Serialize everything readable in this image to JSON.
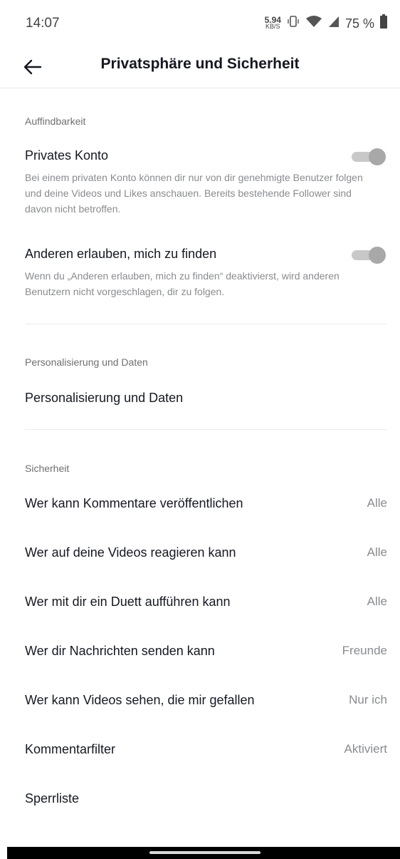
{
  "status_bar": {
    "time": "14:07",
    "net_speed_value": "5.94",
    "net_speed_unit": "KB/S",
    "battery": "75 %",
    "icons": [
      "vibrate-icon",
      "wifi-icon",
      "signal-icon",
      "battery-icon"
    ]
  },
  "header": {
    "title": "Privatsphäre und Sicherheit",
    "back_icon": "arrow-left-icon"
  },
  "discoverability": {
    "section_label": "Auffindbarkeit",
    "private_account": {
      "title": "Privates Konto",
      "description": "Bei einem privaten Konto können dir nur von dir genehmigte Benutzer folgen und deine Videos und Likes anschauen. Bereits bestehende Follower sind davon nicht betroffen.",
      "enabled": true
    },
    "allow_find": {
      "title": "Anderen erlauben, mich zu finden",
      "description": "Wenn du „Anderen erlauben, mich zu finden“ deaktivierst, wird anderen Benutzern nicht vorgeschlagen, dir zu folgen.",
      "enabled": true
    }
  },
  "personalization": {
    "section_label": "Personalisierung und Daten",
    "item_label": "Personalisierung und Daten"
  },
  "security": {
    "section_label": "Sicherheit",
    "items": [
      {
        "label": "Wer kann Kommentare veröffentlichen",
        "value": "Alle"
      },
      {
        "label": "Wer auf deine Videos reagieren kann",
        "value": "Alle"
      },
      {
        "label": "Wer mit dir ein Duett aufführen kann",
        "value": "Alle"
      },
      {
        "label": "Wer dir Nachrichten senden kann",
        "value": "Freunde"
      },
      {
        "label": "Wer kann Videos sehen, die mir gefallen",
        "value": "Nur ich"
      },
      {
        "label": "Kommentarfilter",
        "value": "Aktiviert"
      },
      {
        "label": "Sperrliste",
        "value": ""
      }
    ]
  },
  "colors": {
    "toggle_track": "#c8c8c8",
    "toggle_knob": "#a8a8a8",
    "secondary_text": "#8a8b91"
  }
}
